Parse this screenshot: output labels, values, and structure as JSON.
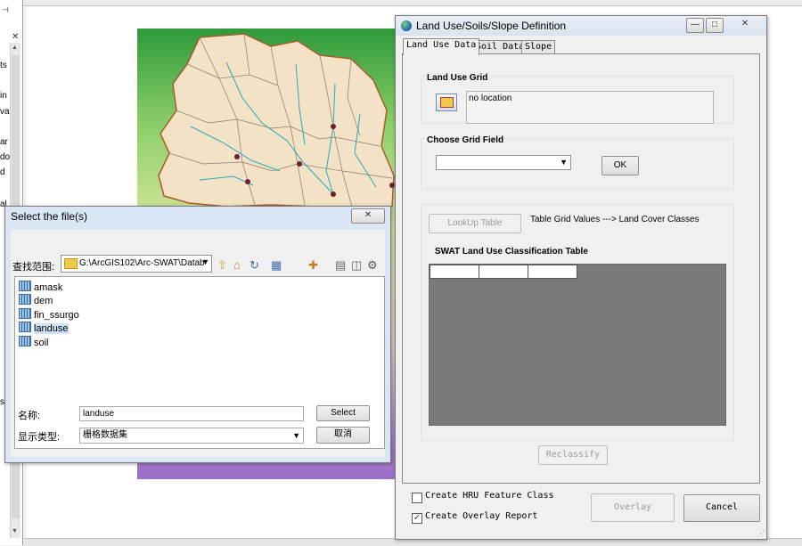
{
  "arcmap": {
    "toc_fragments": [
      "ts",
      "in",
      "val",
      "ar",
      "do",
      "d",
      "al",
      "s"
    ]
  },
  "file_dialog": {
    "title": "Select the file(s)",
    "close_label": "✕",
    "look_in_label": "查找范围:",
    "look_in_value": "G:\\ArcGIS102\\Arc-SWAT\\Datab",
    "files": [
      "amask",
      "dem",
      "fin_ssurgo",
      "landuse",
      "soil"
    ],
    "selected_file": "landuse",
    "name_label": "名称:",
    "name_value": "landuse",
    "type_label": "显示类型:",
    "type_value": "栅格数据集",
    "select_label": "Select",
    "cancel_label": "取消"
  },
  "lus_dialog": {
    "title": "Land Use/Soils/Slope Definition",
    "tabs": [
      "Land Use Data",
      "Soil Data",
      "Slope"
    ],
    "active_tab": "Land Use Data",
    "land_use_grid_label": "Land Use Grid",
    "location_text": "no location",
    "choose_field_label": "Choose Grid Field",
    "ok_label": "OK",
    "lookup_label": "LookUp Table",
    "lookup_caption": "Table Grid Values ---> Land Cover Classes",
    "swat_table_label": "SWAT Land Use Classification Table",
    "reclassify_label": "Reclassify",
    "create_hru_label": "Create HRU Feature Class",
    "create_hru_checked": false,
    "create_overlay_label": "Create Overlay Report",
    "create_overlay_checked": true,
    "overlay_label": "Overlay",
    "cancel_label": "Cancel"
  }
}
